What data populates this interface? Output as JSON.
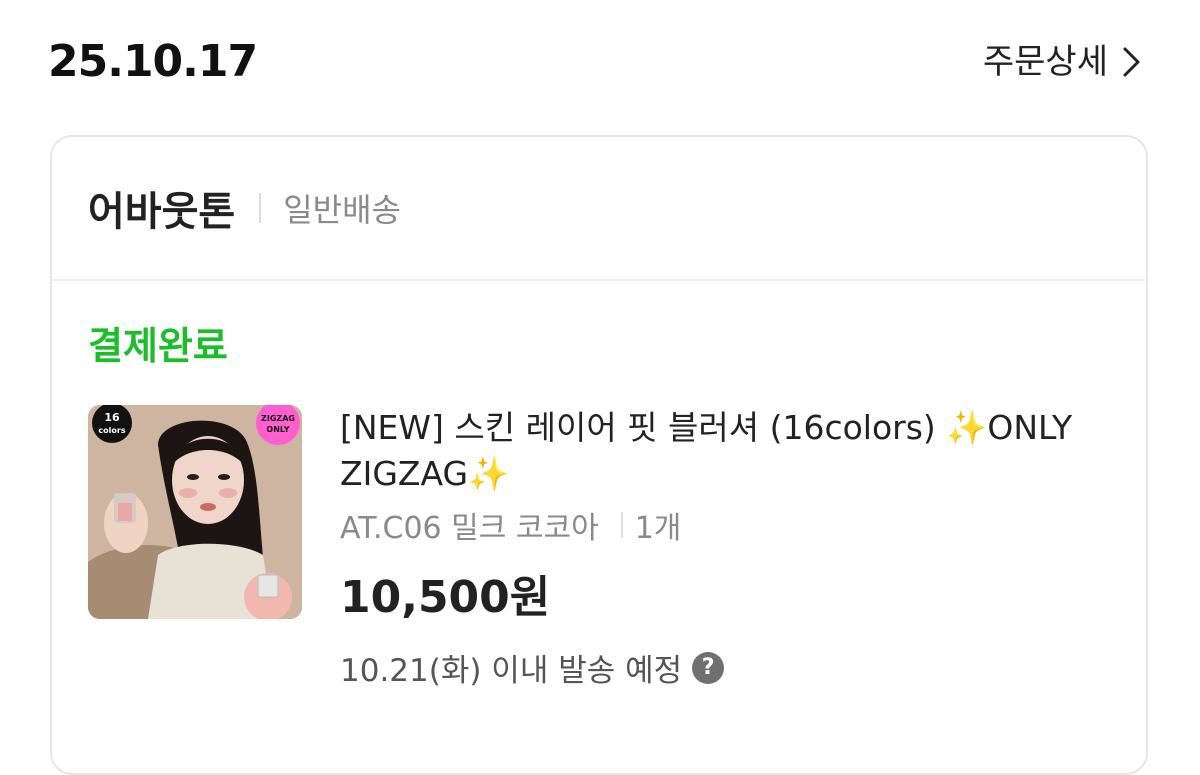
{
  "order": {
    "date": "25.10.17",
    "detail_link": "주문상세"
  },
  "store": {
    "name": "어바웃톤",
    "shipping_type": "일반배송"
  },
  "status": {
    "label": "결제완료",
    "color": "#1bbd29"
  },
  "product": {
    "title": "[NEW] 스킨 레이어 핏 블러셔 (16colors) ✨ONLY ZIGZAG✨",
    "option": "AT.C06 밀크 코코아",
    "quantity": "1개",
    "price": "10,500원",
    "shipping_note": "10.21(화) 이내 발송 예정",
    "thumbnail": {
      "badge_left": [
        "16",
        "colors"
      ],
      "badge_right": [
        "ZIGZAG",
        "ONLY"
      ]
    }
  },
  "icons": {
    "detail_chevron": "chevron-right-icon",
    "help": "question-circle-icon"
  }
}
